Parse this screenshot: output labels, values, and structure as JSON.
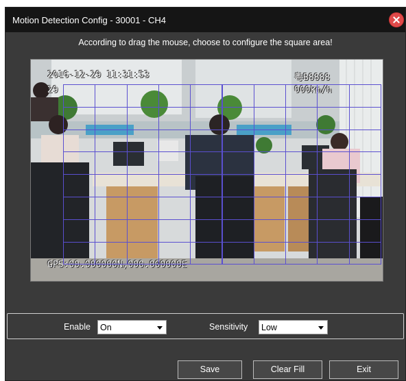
{
  "window": {
    "title": "Motion Detection Config - 30001 - CH4"
  },
  "instruction": "According to drag the mouse, choose to configure the square area!",
  "video": {
    "datetime": "2016-12-29 11:31:53",
    "plate": "粤B8888",
    "left_counter": "29",
    "speed": "000km/h",
    "gps": "GPS:00.000000N,000.000000E"
  },
  "controls": {
    "enable_label": "Enable",
    "enable_value": "On",
    "sensitivity_label": "Sensitivity",
    "sensitivity_value": "Low"
  },
  "buttons": {
    "save": "Save",
    "clear_fill": "Clear Fill",
    "exit": "Exit"
  },
  "colors": {
    "grid": "#5a4fd0",
    "close": "#e04a4a"
  }
}
